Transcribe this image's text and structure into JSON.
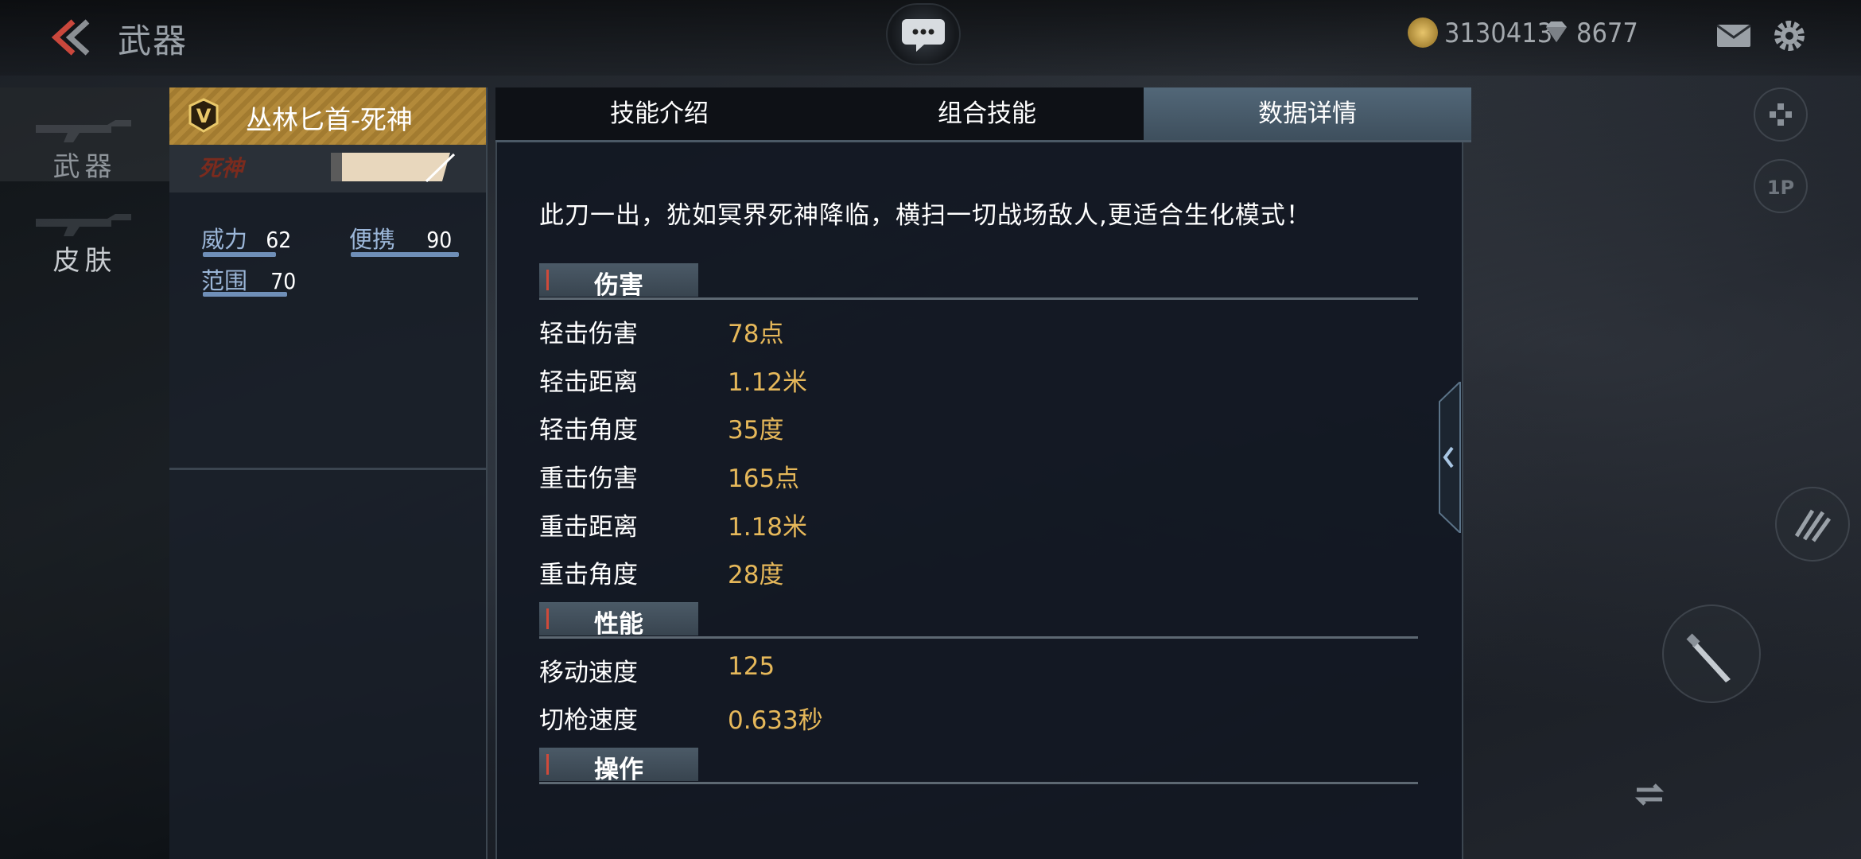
{
  "topbar": {
    "title": "武器",
    "coins": "3130413",
    "gems": "8677"
  },
  "sidenav": {
    "items": [
      {
        "label": "武器",
        "active": true
      },
      {
        "label": "皮肤",
        "active": false
      }
    ]
  },
  "weapon": {
    "name": "丛林匕首-死神",
    "skin_tag": "死神",
    "stats": {
      "power_label": "威力",
      "power_value": "62",
      "portability_label": "便携",
      "portability_value": "90",
      "range_label": "范围",
      "range_value": "70"
    }
  },
  "tabs": [
    {
      "label": "技能介绍",
      "active": false
    },
    {
      "label": "组合技能",
      "active": false
    },
    {
      "label": "数据详情",
      "active": true
    }
  ],
  "details": {
    "description": "此刀一出，犹如冥界死神降临，横扫一切战场敌人,更适合生化模式！",
    "sections": [
      {
        "title": "伤害",
        "rows": [
          {
            "label": "轻击伤害",
            "value": "78点"
          },
          {
            "label": "轻击距离",
            "value": "1.12米"
          },
          {
            "label": "轻击角度",
            "value": "35度"
          },
          {
            "label": "重击伤害",
            "value": "165点"
          },
          {
            "label": "重击距离",
            "value": "1.18米"
          },
          {
            "label": "重击角度",
            "value": "28度"
          }
        ]
      },
      {
        "title": "性能",
        "rows": [
          {
            "label": "移动速度",
            "value": "125"
          },
          {
            "label": "切枪速度",
            "value": "0.633秒"
          }
        ]
      },
      {
        "title": "操作",
        "rows": []
      }
    ]
  },
  "colors": {
    "accent_gold": "#e6b85a",
    "stat_label_blue": "#9bb6d8",
    "active_tab": "#526778"
  }
}
